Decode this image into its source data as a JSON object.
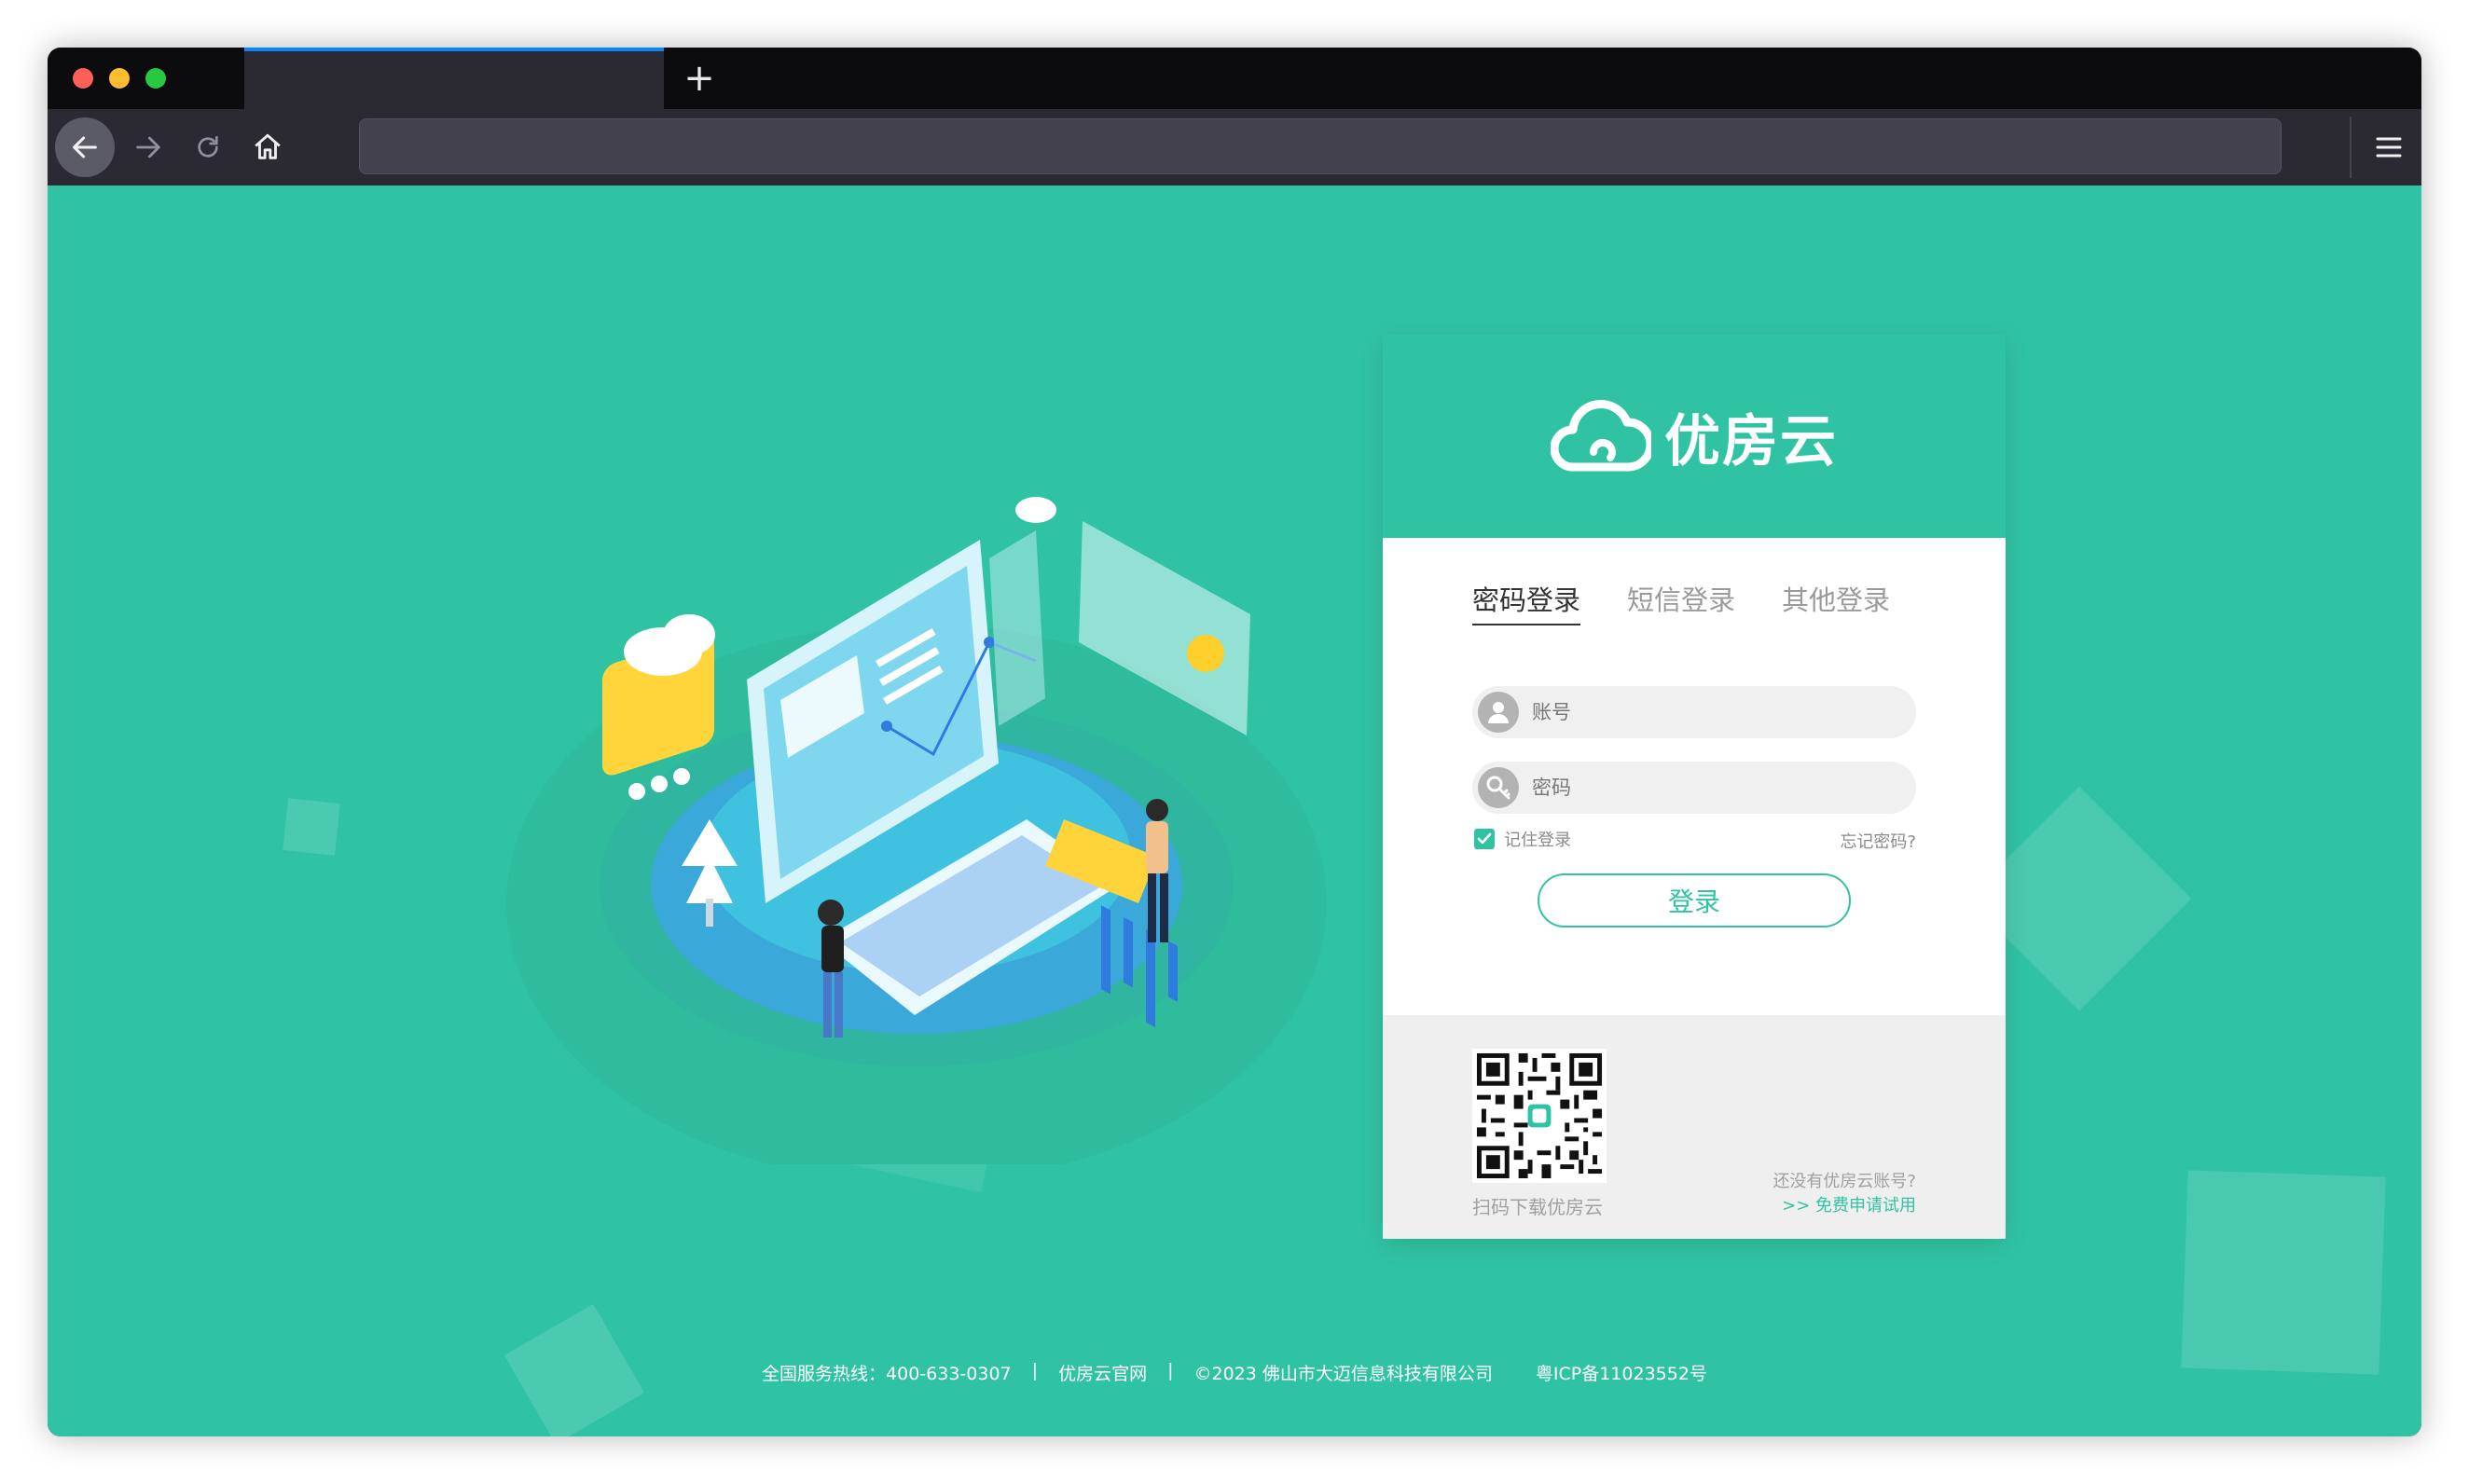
{
  "browser": {
    "new_tab_label": "+",
    "url": ""
  },
  "login": {
    "brand": "优房云",
    "tabs": [
      {
        "label": "密码登录",
        "active": true
      },
      {
        "label": "短信登录",
        "active": false
      },
      {
        "label": "其他登录",
        "active": false
      }
    ],
    "account_placeholder": "账号",
    "password_placeholder": "密码",
    "remember_label": "记住登录",
    "remember_checked": true,
    "forgot_label": "忘记密码?",
    "submit_label": "登录",
    "qr_caption": "扫码下载优房云",
    "no_account_text": "还没有优房云账号?",
    "trial_link": ">> 免费申请试用"
  },
  "footer": {
    "hotline": "全国服务热线：400-633-0307",
    "divider": "|",
    "official_site": "优房云官网",
    "copyright": "©2023 佛山市大迈信息科技有限公司",
    "icp": "粤ICP备11023552号"
  },
  "colors": {
    "accent": "#30c3a3",
    "browser_chrome": "#2b2a33",
    "tab_highlight": "#0a84ff"
  },
  "icons": [
    "back-arrow-icon",
    "forward-arrow-icon",
    "reload-icon",
    "home-icon",
    "hamburger-menu-icon",
    "user-icon",
    "key-icon",
    "checkbox-check-icon",
    "cloud-logo-icon",
    "qr-code"
  ]
}
